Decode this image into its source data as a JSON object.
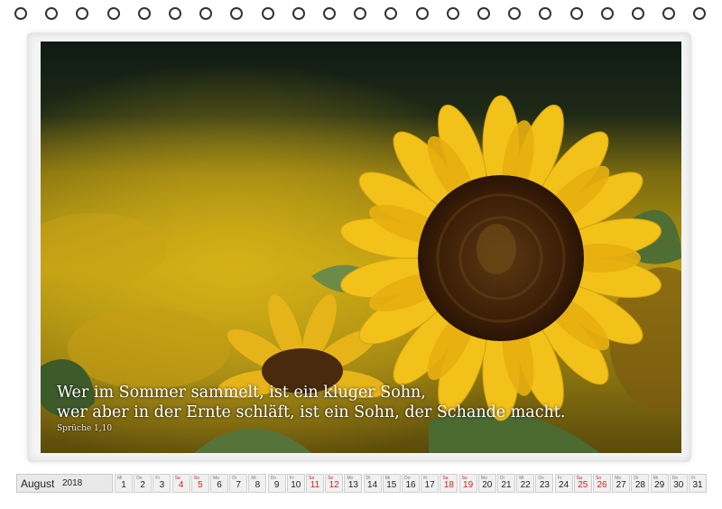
{
  "quote": {
    "line1": "Wer im Sommer sammelt, ist ein kluger Sohn,",
    "line2": "wer aber in der Ernte schläft, ist ein Sohn, der Schande macht.",
    "source": "Sprüche 1,10"
  },
  "calendar": {
    "month": "August",
    "year": "2018",
    "days": [
      {
        "wd": "Mi",
        "day": "1",
        "weekend": false
      },
      {
        "wd": "Do",
        "day": "2",
        "weekend": false
      },
      {
        "wd": "Fr",
        "day": "3",
        "weekend": false
      },
      {
        "wd": "Sa",
        "day": "4",
        "weekend": true
      },
      {
        "wd": "So",
        "day": "5",
        "weekend": true
      },
      {
        "wd": "Mo",
        "day": "6",
        "weekend": false
      },
      {
        "wd": "Di",
        "day": "7",
        "weekend": false
      },
      {
        "wd": "Mi",
        "day": "8",
        "weekend": false
      },
      {
        "wd": "Do",
        "day": "9",
        "weekend": false
      },
      {
        "wd": "Fr",
        "day": "10",
        "weekend": false
      },
      {
        "wd": "Sa",
        "day": "11",
        "weekend": true
      },
      {
        "wd": "So",
        "day": "12",
        "weekend": true
      },
      {
        "wd": "Mo",
        "day": "13",
        "weekend": false
      },
      {
        "wd": "Di",
        "day": "14",
        "weekend": false
      },
      {
        "wd": "Mi",
        "day": "15",
        "weekend": false
      },
      {
        "wd": "Do",
        "day": "16",
        "weekend": false
      },
      {
        "wd": "Fr",
        "day": "17",
        "weekend": false
      },
      {
        "wd": "Sa",
        "day": "18",
        "weekend": true
      },
      {
        "wd": "So",
        "day": "19",
        "weekend": true
      },
      {
        "wd": "Mo",
        "day": "20",
        "weekend": false
      },
      {
        "wd": "Di",
        "day": "21",
        "weekend": false
      },
      {
        "wd": "Mi",
        "day": "22",
        "weekend": false
      },
      {
        "wd": "Do",
        "day": "23",
        "weekend": false
      },
      {
        "wd": "Fr",
        "day": "24",
        "weekend": false
      },
      {
        "wd": "Sa",
        "day": "25",
        "weekend": true
      },
      {
        "wd": "So",
        "day": "26",
        "weekend": true
      },
      {
        "wd": "Mo",
        "day": "27",
        "weekend": false
      },
      {
        "wd": "Di",
        "day": "28",
        "weekend": false
      },
      {
        "wd": "Mi",
        "day": "29",
        "weekend": false
      },
      {
        "wd": "Do",
        "day": "30",
        "weekend": false
      },
      {
        "wd": "Fr",
        "day": "31",
        "weekend": false
      }
    ]
  },
  "colors": {
    "weekend": "#cc2222",
    "petal": "#f2c21a",
    "center": "#4a2a0c",
    "leaf": "#5a7a3a"
  }
}
